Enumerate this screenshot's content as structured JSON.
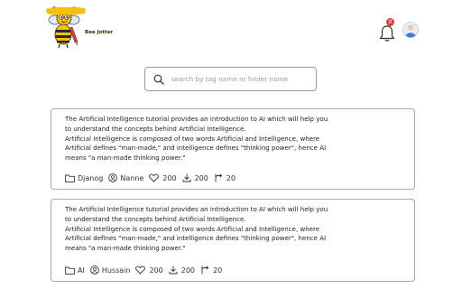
{
  "header": {
    "logo_text": "Bee Jotter",
    "notification_count": "0",
    "colors": {
      "brand_yellow": "#f4c20d",
      "badge_red": "#e23b3b",
      "avatar_blue": "#3b7dd8"
    },
    "icons": {
      "logo": "bee-mascot",
      "notifications": "bell-icon",
      "profile": "user-avatar"
    }
  },
  "search": {
    "placeholder": "search by tag name or folder name",
    "value": "",
    "icon": "search-icon"
  },
  "posts": [
    {
      "text": "The Artificial Intelligence tutorial provides an introduction to AI which will help you\nto understand the concepts behind Artificial Intelligence.\nArtificial Intelligence is composed of two words Artificial and Intelligence, where\nArtificial defines \"man-made,\" and intelligence defines \"thinking power\", hence AI\nmeans \"a man-made thinking power.\"",
      "folder": "Djanog",
      "author": "Nanne",
      "likes": "200",
      "downloads": "200",
      "remixes": "20"
    },
    {
      "text": "The Artificial Intelligence tutorial provides an introduction to AI which will help you\nto understand the concepts behind Artificial Intelligence.\nArtificial Intelligence is composed of two words Artificial and Intelligence, where\nArtificial defines \"man-made,\" and intelligence defines \"thinking power\", hence AI\nmeans \"a man-made thinking power.\"",
      "folder": "AI",
      "author": "Hussain",
      "likes": "200",
      "downloads": "200",
      "remixes": "20"
    }
  ]
}
